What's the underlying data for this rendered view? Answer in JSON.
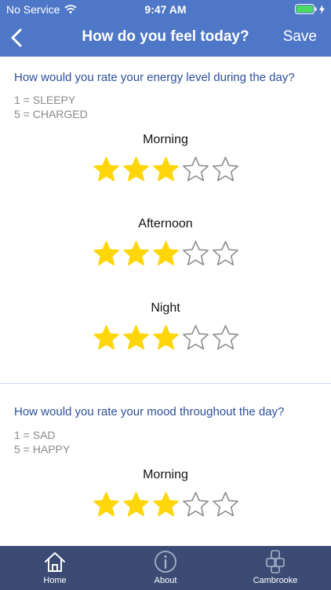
{
  "status_bar": {
    "carrier": "No Service",
    "time": "9:47 AM"
  },
  "nav": {
    "title": "How do you feel today?",
    "save_label": "Save"
  },
  "sections": [
    {
      "question": "How would you rate your energy level during the day?",
      "scale": [
        "1 = SLEEPY",
        "5 = CHARGED"
      ],
      "ratings": [
        {
          "label": "Morning",
          "value": 3,
          "max": 5
        },
        {
          "label": "Afternoon",
          "value": 3,
          "max": 5
        },
        {
          "label": "Night",
          "value": 3,
          "max": 5
        }
      ]
    },
    {
      "question": "How would you rate your mood throughout the day?",
      "scale": [
        "1 = SAD",
        "5 = HAPPY"
      ],
      "ratings": [
        {
          "label": "Morning",
          "value": 3,
          "max": 5
        }
      ]
    }
  ],
  "tabs": [
    {
      "label": "Home",
      "icon": "home-icon"
    },
    {
      "label": "About",
      "icon": "info-icon"
    },
    {
      "label": "Cambrooke",
      "icon": "cambrooke-logo-icon"
    }
  ],
  "colors": {
    "header": "#4f77c7",
    "tab_bar": "#3b4b73",
    "star_filled": "#ffd60a",
    "question_text": "#2d4f9a"
  }
}
